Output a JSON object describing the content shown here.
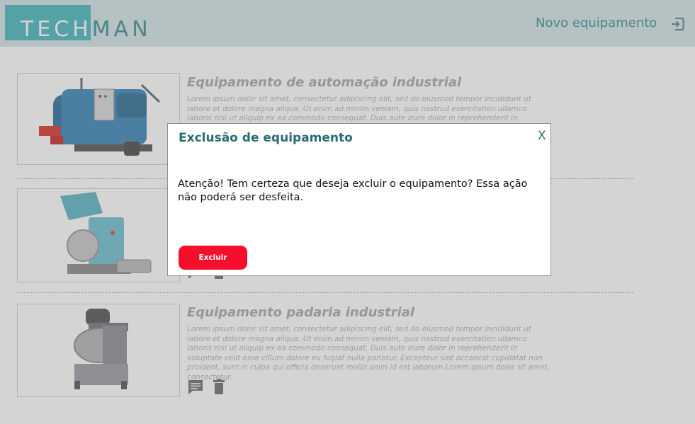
{
  "header": {
    "logo_part1": "TECH",
    "logo_part2": "MAN",
    "new_equipment_label": "Novo equipamento",
    "logout_icon": "logout-icon"
  },
  "equipment": [
    {
      "title": "Equipamento de automação industrial",
      "description": "Lorem ipsum dolor sit amet, consectetur adipiscing elit, sed do eiusmod tempor incididunt ut labore et dolore magna aliqua. Ut enim ad minim veniam, quis nostrud exercitation ullamco laboris nisi ut aliquip ex ea commodo consequat. Duis aute irure dolor in reprehenderit in voluptate velit",
      "image": "industrial-boiler-image"
    },
    {
      "title": "",
      "description": "",
      "image": "industrial-mixer-image"
    },
    {
      "title": "Equipamento padaria industrial",
      "description": "Lorem ipsum dolor sit amet, consectetur adipiscing elit, sed do eiusmod tempor incididunt ut labore et dolore magna aliqua. Ut enim ad minim veniam, quis nostrud exercitation ullamco laboris nisi ut aliquip ex ea commodo consequat. Duis aute irure dolor in reprehenderit in voluptate velit esse cillum dolore eu fugiat nulla pariatur. Excepteur sint occaecat cupidatat non proident, sunt in culpa qui officia deserunt mollit anim id est laborum.Lorem ipsum dolor sit amet, consectetur.",
      "image": "bakery-mixer-image"
    }
  ],
  "modal": {
    "title": "Exclusão de equipamento",
    "close_label": "X",
    "message": "Atenção! Tem certeza que deseja excluir o equipamento? Essa ação não poderá ser desfeita.",
    "confirm_label": "Excluir"
  },
  "colors": {
    "header_bg": "#d3e4e6",
    "brand_teal": "#48b6bd",
    "brand_dark_teal": "#2c6d72",
    "danger": "#f50f2d"
  }
}
